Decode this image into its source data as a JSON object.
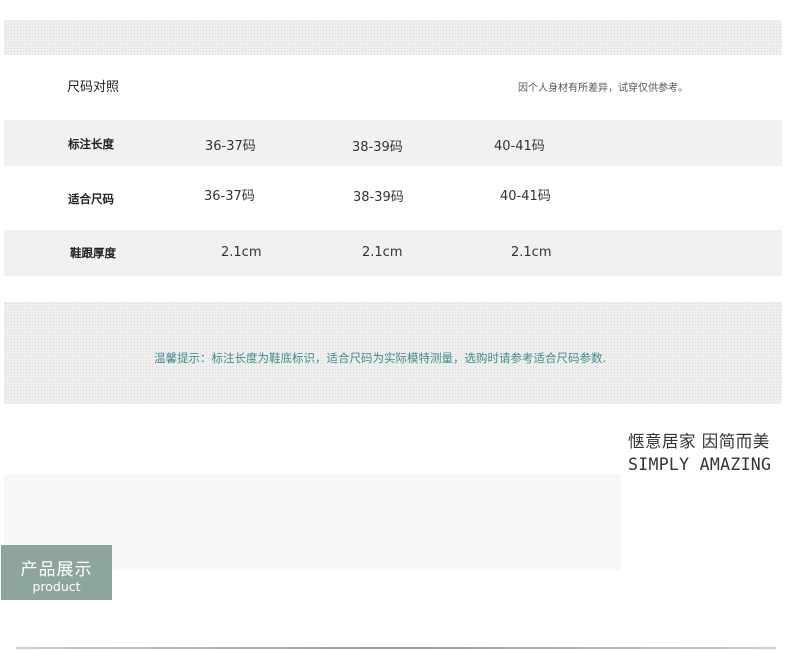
{
  "size_chart": {
    "title": "尺码对照",
    "note": "因个人身材有所差异，试穿仅供参考。",
    "rows": [
      {
        "label": "标注长度",
        "values": [
          "36-37码",
          "38-39码",
          "40-41码"
        ]
      },
      {
        "label": "适合尺码",
        "values": [
          "36-37码",
          "38-39码",
          "40-41码"
        ]
      },
      {
        "label": "鞋跟厚度",
        "values": [
          "2.1cm",
          "2.1cm",
          "2.1cm"
        ]
      }
    ]
  },
  "tip": "温馨提示：标注长度为鞋底标识，适合尺码为实际模特测量，选购时请参考适合尺码参数.",
  "slogan": {
    "cn": "惬意居家 因简而美",
    "en": "SIMPLY AMAZING"
  },
  "product_badge": {
    "cn": "产品展示",
    "en": "product"
  },
  "colors": {
    "tip_text": "#3a8f8c",
    "badge_bg": "#8ea59b"
  }
}
